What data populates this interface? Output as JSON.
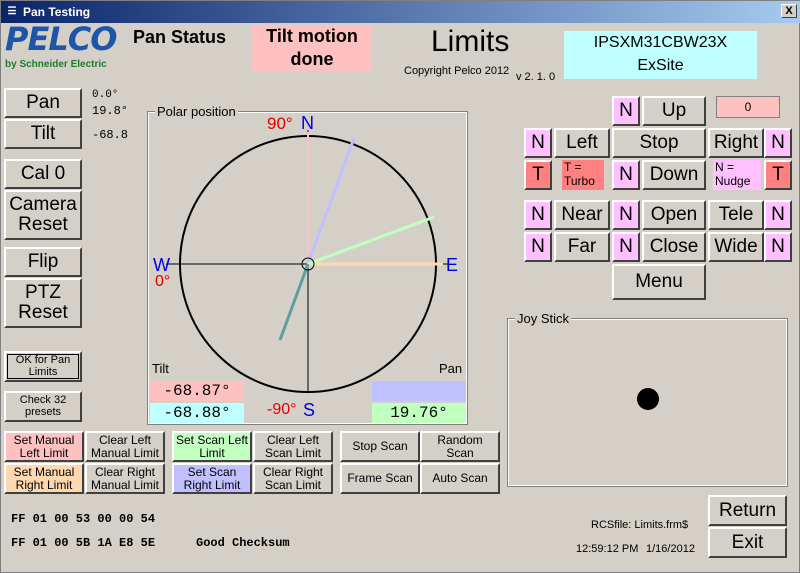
{
  "window": {
    "title": "Pan Testing",
    "close": "X"
  },
  "logo": {
    "brand": "PELCO",
    "tagline": "by Schneider Electric"
  },
  "header": {
    "pan_status_label": "Pan Status",
    "status_message": "Tilt motion done",
    "page_title": "Limits",
    "copyright": "Copyright Pelco 2012",
    "version": "v 2. 1. 0",
    "device_model": "IPSXM31CBW23X",
    "site": "ExSite"
  },
  "left_buttons": {
    "pan": "Pan",
    "tilt": "Tilt",
    "cal0": "Cal 0",
    "camera_reset": "Camera Reset",
    "flip": "Flip",
    "ptz_reset": "PTZ Reset",
    "ok_pan_limits": "OK for Pan Limits",
    "check_presets": "Check 32 presets"
  },
  "pan_tilt_values": {
    "pan_raw": "0.0°",
    "pan_deg": "19.8°",
    "tilt_deg": "-68.8"
  },
  "polar": {
    "legend": "Polar position",
    "label_90": "90°",
    "label_n": "N",
    "label_w": "W",
    "label_0": "0°",
    "label_e": "E",
    "label_m90": "-90°",
    "label_s": "S",
    "tilt_label": "Tilt",
    "pan_label": "Pan",
    "tilt_value_1": "-68.87°",
    "tilt_value_2": "-68.88°",
    "pan_value_2": "19.76°",
    "colors": {
      "tilt1": "#ffc0c0",
      "tilt2": "#c0ffff",
      "pan1": "#c0c0ff",
      "pan2": "#c0ffc0"
    }
  },
  "scan_buttons": {
    "set_manual_left": "Set Manual Left Limit",
    "clear_left_manual": "Clear Left Manual Limit",
    "set_scan_left": "Set Scan Left Limit",
    "clear_left_scan": "Clear Left Scan Limit",
    "set_manual_right": "Set Manual Right Limit",
    "clear_right_manual": "Clear Right Manual Limit",
    "set_scan_right": "Set Scan Right Limit",
    "clear_right_scan": "Clear Right Scan Limit",
    "stop_scan": "Stop Scan",
    "random_scan": "Random Scan",
    "frame_scan": "Frame Scan",
    "auto_scan": "Auto Scan"
  },
  "ptz_controls": {
    "n": "N",
    "t": "T",
    "up": "Up",
    "left": "Left",
    "stop": "Stop",
    "right": "Right",
    "down": "Down",
    "turbo_hint": "T = Turbo",
    "nudge_hint": "N = Nudge",
    "near": "Near",
    "open": "Open",
    "tele": "Tele",
    "far": "Far",
    "close": "Close",
    "wide": "Wide",
    "menu": "Menu",
    "counter": "0"
  },
  "joystick": {
    "legend": "Joy Stick"
  },
  "footer": {
    "cmd_line_1": "FF 01 00 53 00 00 54",
    "cmd_line_2": "FF 01 00 5B 1A E8 5E",
    "checksum": "Good Checksum",
    "rcs_file": "RCSfile: Limits.frm$",
    "time": "12:59:12 PM",
    "date": "1/16/2012",
    "return": "Return",
    "exit": "Exit"
  }
}
